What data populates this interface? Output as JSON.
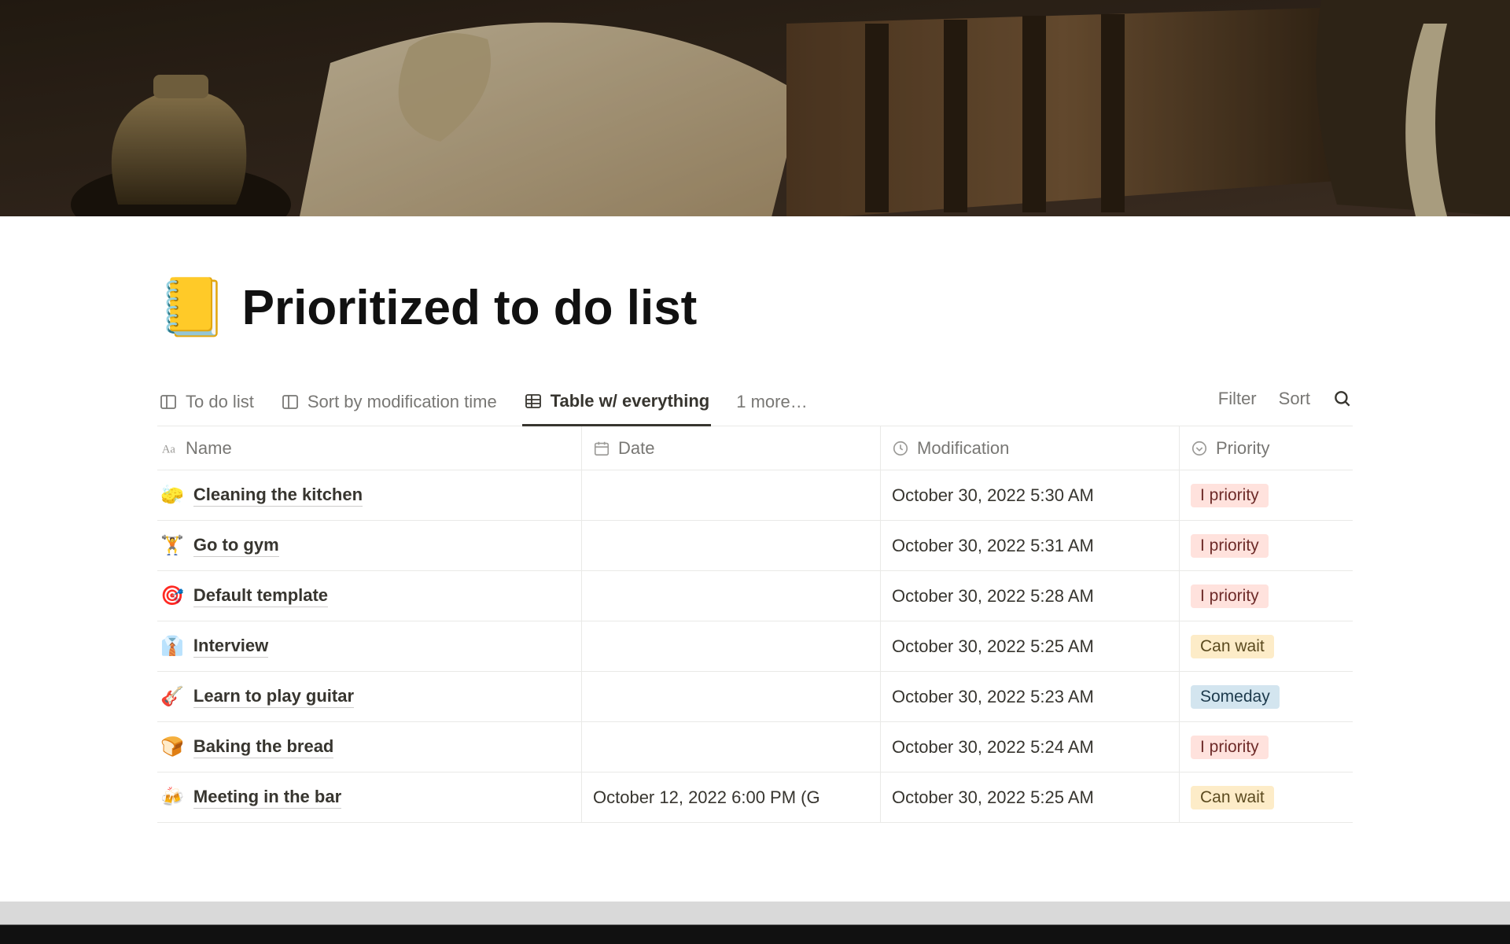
{
  "page": {
    "emoji": "📒",
    "title": "Prioritized to do list"
  },
  "views": {
    "tabs": [
      {
        "icon": "board",
        "label": "To do list",
        "active": false
      },
      {
        "icon": "board",
        "label": "Sort by modification time",
        "active": false
      },
      {
        "icon": "table",
        "label": "Table w/ everything",
        "active": true
      }
    ],
    "more": "1 more…",
    "filter": "Filter",
    "sort": "Sort"
  },
  "columns": {
    "name": "Name",
    "date": "Date",
    "modification": "Modification",
    "priority": "Priority"
  },
  "priority_colors": {
    "I priority": "pill-red",
    "Can wait": "pill-yellow",
    "Someday": "pill-blue"
  },
  "rows": [
    {
      "emoji": "🧽",
      "name": "Cleaning the kitchen",
      "date": "",
      "mod": "October 30, 2022 5:30 AM",
      "priority": "I priority"
    },
    {
      "emoji": "🏋️",
      "name": "Go to gym",
      "date": "",
      "mod": "October 30, 2022 5:31 AM",
      "priority": "I priority"
    },
    {
      "emoji": "🎯",
      "name": "Default template",
      "date": "",
      "mod": "October 30, 2022 5:28 AM",
      "priority": "I priority"
    },
    {
      "emoji": "👔",
      "name": "Interview",
      "date": "",
      "mod": "October 30, 2022 5:25 AM",
      "priority": "Can wait"
    },
    {
      "emoji": "🎸",
      "name": "Learn to play guitar",
      "date": "",
      "mod": "October 30, 2022 5:23 AM",
      "priority": "Someday"
    },
    {
      "emoji": "🍞",
      "name": "Baking the bread",
      "date": "",
      "mod": "October 30, 2022 5:24 AM",
      "priority": "I priority"
    },
    {
      "emoji": "🍻",
      "name": "Meeting in the bar",
      "date": "October 12, 2022 6:00 PM (G",
      "mod": "October 30, 2022 5:25 AM",
      "priority": "Can wait"
    }
  ]
}
